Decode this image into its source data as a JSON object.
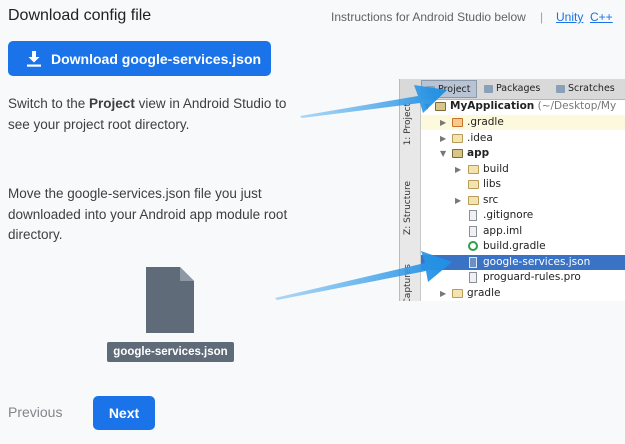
{
  "header": {
    "title": "Download config file",
    "instructions": "Instructions for Android Studio below",
    "separator": "|",
    "unity_link": "Unity",
    "cpp_link": "C++"
  },
  "download_button": {
    "label": "Download google-services.json",
    "icon": "download-icon"
  },
  "step1": {
    "text_before": "Switch to the ",
    "text_bold": "Project",
    "text_after": " view in Android Studio to see your project root directory."
  },
  "step2": {
    "text": "Move the google-services.json file you just downloaded into your Android app module root directory."
  },
  "file_card": {
    "label": "google-services.json",
    "icon": "file-icon"
  },
  "footer": {
    "previous": "Previous",
    "next": "Next"
  },
  "ide": {
    "tabs": [
      "Project",
      "Packages",
      "Scratches"
    ],
    "side_labels": [
      "1: Project",
      "Z: Structure",
      "Captures"
    ],
    "tree": [
      {
        "label": "MyApplication",
        "suffix": "(~/Desktop/My",
        "icon": "module-folder-icon"
      },
      {
        "label": ".gradle",
        "icon": "folder-icon"
      },
      {
        "label": ".idea",
        "icon": "folder-icon"
      },
      {
        "label": "app",
        "icon": "module-folder-icon"
      },
      {
        "label": "build",
        "icon": "folder-icon"
      },
      {
        "label": "libs",
        "icon": "folder-icon"
      },
      {
        "label": "src",
        "icon": "folder-icon"
      },
      {
        "label": ".gitignore",
        "icon": "text-file-icon"
      },
      {
        "label": "app.iml",
        "icon": "iml-file-icon"
      },
      {
        "label": "build.gradle",
        "icon": "gradle-icon"
      },
      {
        "label": "google-services.json",
        "icon": "json-file-icon"
      },
      {
        "label": "proguard-rules.pro",
        "icon": "text-file-icon"
      },
      {
        "label": "gradle",
        "icon": "folder-icon"
      }
    ]
  },
  "colors": {
    "accent": "#1a73e8",
    "selection": "#3a72c6",
    "arrow": "#1e96e6"
  }
}
